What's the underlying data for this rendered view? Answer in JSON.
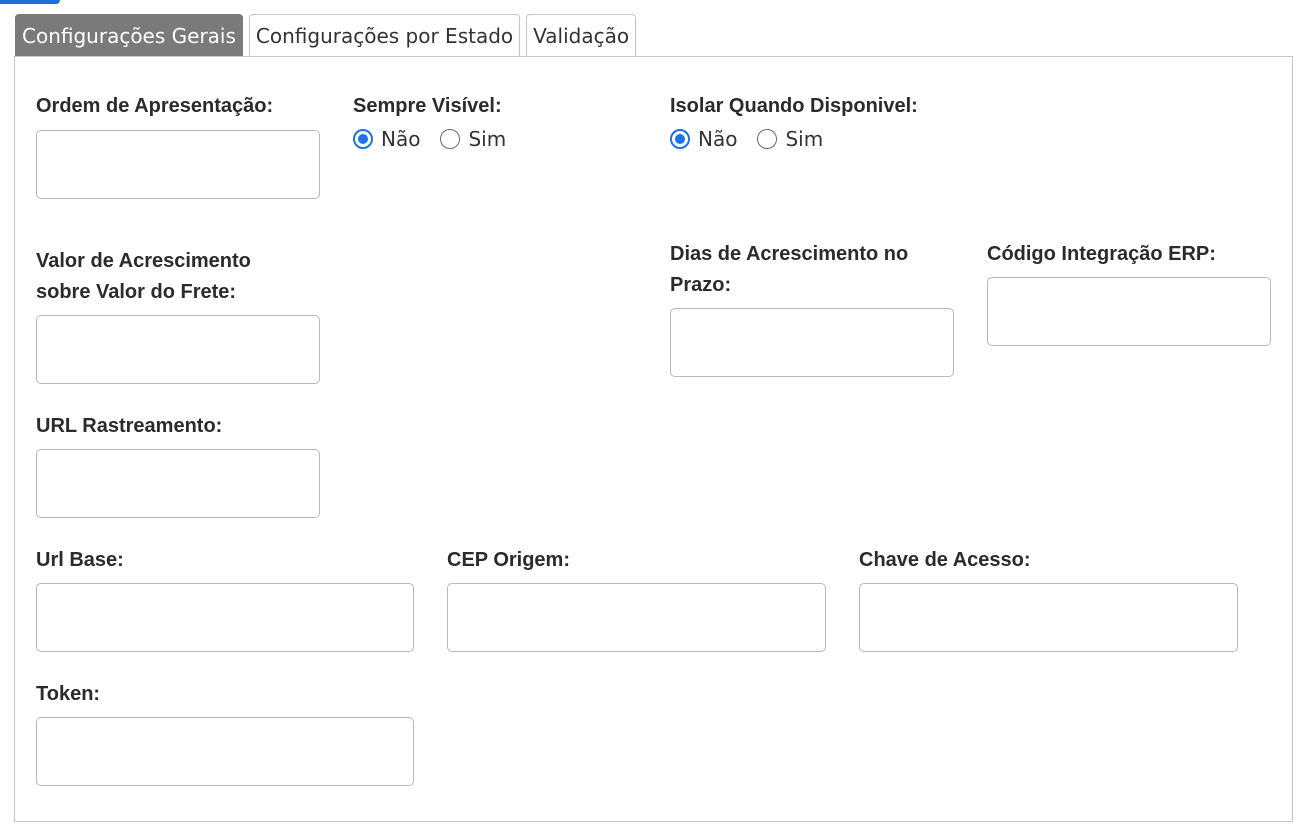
{
  "tabs": [
    {
      "label": "Configurações Gerais",
      "active": true
    },
    {
      "label": "Configurações por Estado",
      "active": false
    },
    {
      "label": "Validação",
      "active": false
    }
  ],
  "form": {
    "ordem_apresentacao": {
      "label": "Ordem de Apresentação:",
      "value": ""
    },
    "sempre_visivel": {
      "label": "Sempre Visível:",
      "options": [
        "Não",
        "Sim"
      ],
      "selected": "Não"
    },
    "isolar_disponivel": {
      "label": "Isolar Quando Disponivel:",
      "options": [
        "Não",
        "Sim"
      ],
      "selected": "Não"
    },
    "valor_acrescimento": {
      "label_line1": "Valor de Acrescimento",
      "label_line2": "sobre Valor do Frete:",
      "value": ""
    },
    "dias_acrescimento": {
      "label_line1": "Dias de Acrescimento no",
      "label_line2": "Prazo:",
      "value": ""
    },
    "codigo_erp": {
      "label": "Código Integração ERP:",
      "value": ""
    },
    "url_rastreamento": {
      "label": "URL Rastreamento:",
      "value": ""
    },
    "url_base": {
      "label": "Url Base:",
      "value": ""
    },
    "cep_origem": {
      "label": "CEP Origem:",
      "value": ""
    },
    "chave_acesso": {
      "label": "Chave de Acesso:",
      "value": ""
    },
    "token": {
      "label": "Token:",
      "value": ""
    }
  },
  "colors": {
    "active_tab_bg": "#7a7a7a",
    "radio_accent": "#1a73e8",
    "border": "#c5c5c5"
  }
}
